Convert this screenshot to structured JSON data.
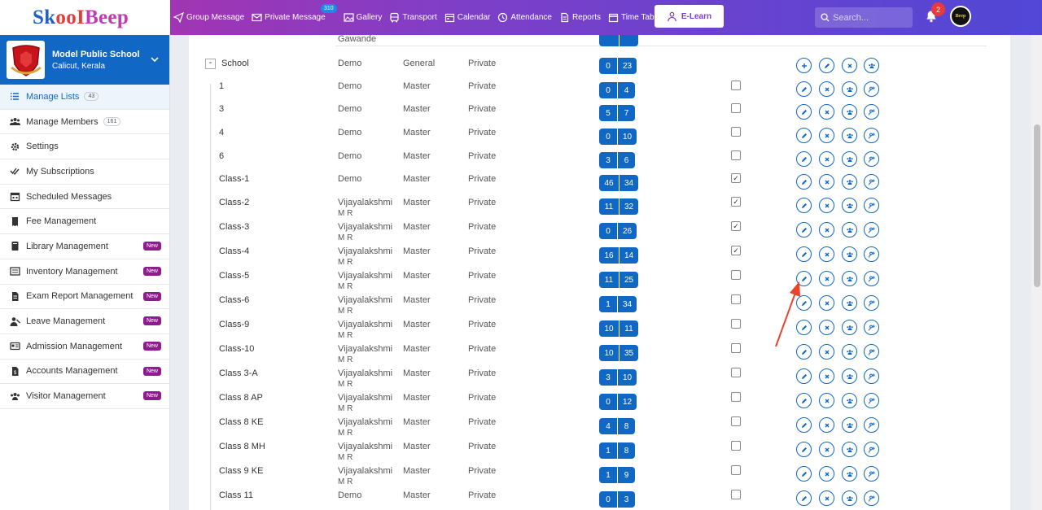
{
  "header": {
    "logo_skool": "Sk",
    "logo_q": "ooI",
    "logo_beep": "Beep",
    "nav": [
      {
        "label": "Group Message",
        "icon": "send-icon"
      },
      {
        "label": "Private Message",
        "icon": "mail-icon",
        "badge": "310"
      },
      {
        "label": "Gallery",
        "icon": "image-icon"
      },
      {
        "label": "Transport",
        "icon": "bus-icon"
      },
      {
        "label": "Calendar",
        "icon": "calendar-icon"
      },
      {
        "label": "Attendance",
        "icon": "clock-icon"
      },
      {
        "label": "Reports",
        "icon": "document-icon"
      },
      {
        "label": "Time Table",
        "icon": "timetable-icon"
      }
    ],
    "elearn": "E-Learn",
    "search_placeholder": "Search...",
    "notifications": "2",
    "avatar_text": "Beep"
  },
  "sidebar": {
    "school_name": "Model Public School",
    "school_location": "Calicut, Kerala",
    "items": [
      {
        "label": "Manage Lists",
        "count": "43",
        "active": true
      },
      {
        "label": "Manage Members",
        "count": "161"
      },
      {
        "label": "Settings"
      },
      {
        "label": "My Subscriptions"
      },
      {
        "label": "Scheduled Messages"
      },
      {
        "label": "Fee Management"
      },
      {
        "label": "Library Management",
        "new": "New"
      },
      {
        "label": "Inventory Management",
        "new": "New"
      },
      {
        "label": "Exam Report Management",
        "new": "New"
      },
      {
        "label": "Leave Management",
        "new": "New"
      },
      {
        "label": "Admission Management",
        "new": "New"
      },
      {
        "label": "Accounts Management",
        "new": "New"
      },
      {
        "label": "Visitor Management",
        "new": "New"
      }
    ]
  },
  "table": {
    "top_partial_owner": "Gawande",
    "parent": {
      "name": "School",
      "owner": "Demo",
      "type": "General",
      "privacy": "Private",
      "a": "0",
      "b": "23"
    },
    "rows": [
      {
        "name": "1",
        "owner1": "Demo",
        "owner2": "",
        "type": "Master",
        "privacy": "Private",
        "a": "0",
        "b": "4",
        "checked": false
      },
      {
        "name": "3",
        "owner1": "Demo",
        "owner2": "",
        "type": "Master",
        "privacy": "Private",
        "a": "5",
        "b": "7",
        "checked": false
      },
      {
        "name": "4",
        "owner1": "Demo",
        "owner2": "",
        "type": "Master",
        "privacy": "Private",
        "a": "0",
        "b": "10",
        "checked": false
      },
      {
        "name": "6",
        "owner1": "Demo",
        "owner2": "",
        "type": "Master",
        "privacy": "Private",
        "a": "3",
        "b": "6",
        "checked": false
      },
      {
        "name": "Class-1",
        "owner1": "Demo",
        "owner2": "",
        "type": "Master",
        "privacy": "Private",
        "a": "46",
        "b": "34",
        "checked": true
      },
      {
        "name": "Class-2",
        "owner1": "Vijayalakshmi",
        "owner2": "M R",
        "type": "Master",
        "privacy": "Private",
        "a": "11",
        "b": "32",
        "checked": true
      },
      {
        "name": "Class-3",
        "owner1": "Vijayalakshmi",
        "owner2": "M R",
        "type": "Master",
        "privacy": "Private",
        "a": "0",
        "b": "26",
        "checked": true
      },
      {
        "name": "Class-4",
        "owner1": "Vijayalakshmi",
        "owner2": "M R",
        "type": "Master",
        "privacy": "Private",
        "a": "16",
        "b": "14",
        "checked": true
      },
      {
        "name": "Class-5",
        "owner1": "Vijayalakshmi",
        "owner2": "M R",
        "type": "Master",
        "privacy": "Private",
        "a": "11",
        "b": "25",
        "checked": false
      },
      {
        "name": "Class-6",
        "owner1": "Vijayalakshmi",
        "owner2": "M R",
        "type": "Master",
        "privacy": "Private",
        "a": "1",
        "b": "34",
        "checked": false
      },
      {
        "name": "Class-9",
        "owner1": "Vijayalakshmi",
        "owner2": "M R",
        "type": "Master",
        "privacy": "Private",
        "a": "10",
        "b": "11",
        "checked": false
      },
      {
        "name": "Class-10",
        "owner1": "Vijayalakshmi",
        "owner2": "M R",
        "type": "Master",
        "privacy": "Private",
        "a": "10",
        "b": "35",
        "checked": false
      },
      {
        "name": "Class 3-A",
        "owner1": "Vijayalakshmi",
        "owner2": "M R",
        "type": "Master",
        "privacy": "Private",
        "a": "3",
        "b": "10",
        "checked": false
      },
      {
        "name": "Class 8 AP",
        "owner1": "Vijayalakshmi",
        "owner2": "M R",
        "type": "Master",
        "privacy": "Private",
        "a": "0",
        "b": "12",
        "checked": false
      },
      {
        "name": "Class 8 KE",
        "owner1": "Vijayalakshmi",
        "owner2": "M R",
        "type": "Master",
        "privacy": "Private",
        "a": "4",
        "b": "8",
        "checked": false
      },
      {
        "name": "Class 8 MH",
        "owner1": "Vijayalakshmi",
        "owner2": "M R",
        "type": "Master",
        "privacy": "Private",
        "a": "1",
        "b": "8",
        "checked": false
      },
      {
        "name": "Class 9 KE",
        "owner1": "Vijayalakshmi",
        "owner2": "M R",
        "type": "Master",
        "privacy": "Private",
        "a": "1",
        "b": "9",
        "checked": false
      },
      {
        "name": "Class 11",
        "owner1": "Demo",
        "owner2": "",
        "type": "Master",
        "privacy": "Private",
        "a": "0",
        "b": "3",
        "checked": false
      }
    ]
  },
  "colors": {
    "primary": "#1167c4",
    "annotation": "#e8452c",
    "new_badge": "#8e1c8e"
  }
}
